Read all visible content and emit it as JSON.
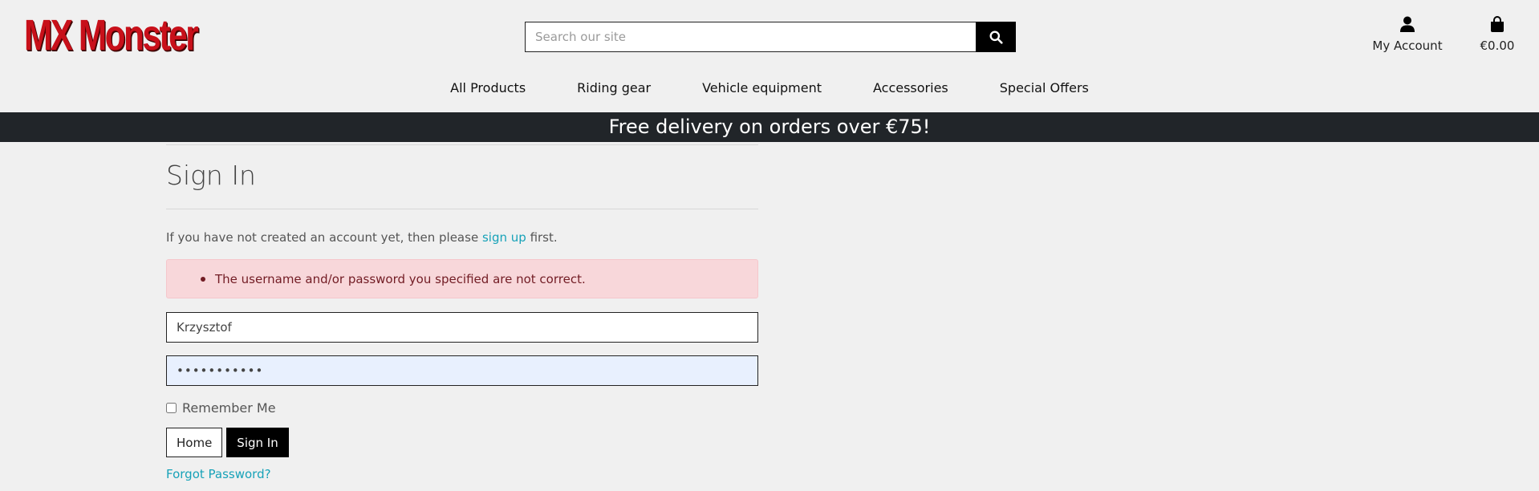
{
  "header": {
    "logo_text": "MX Monster",
    "search_placeholder": "Search our site",
    "account_label": "My Account",
    "cart_total": "€0.00"
  },
  "nav": {
    "items": [
      "All Products",
      "Riding gear",
      "Vehicle equipment",
      "Accessories",
      "Special Offers"
    ]
  },
  "banner": {
    "text": "Free delivery on orders over €75!"
  },
  "signin": {
    "title": "Sign In",
    "notice_prefix": "If you have not created an account yet, then please",
    "notice_link": "sign up",
    "notice_suffix": "first.",
    "error_message": "The username and/or password you specified are not correct.",
    "username_value": "Krzysztof",
    "password_value": "•••••••••••",
    "remember_label": "Remember Me",
    "home_button": "Home",
    "signin_button": "Sign In",
    "forgot_link": "Forgot Password?"
  },
  "colors": {
    "brand": "#c8101a",
    "banner_bg": "#212529",
    "link": "#17a2b8",
    "alert_bg": "#f8d7da",
    "alert_text": "#721c24"
  }
}
